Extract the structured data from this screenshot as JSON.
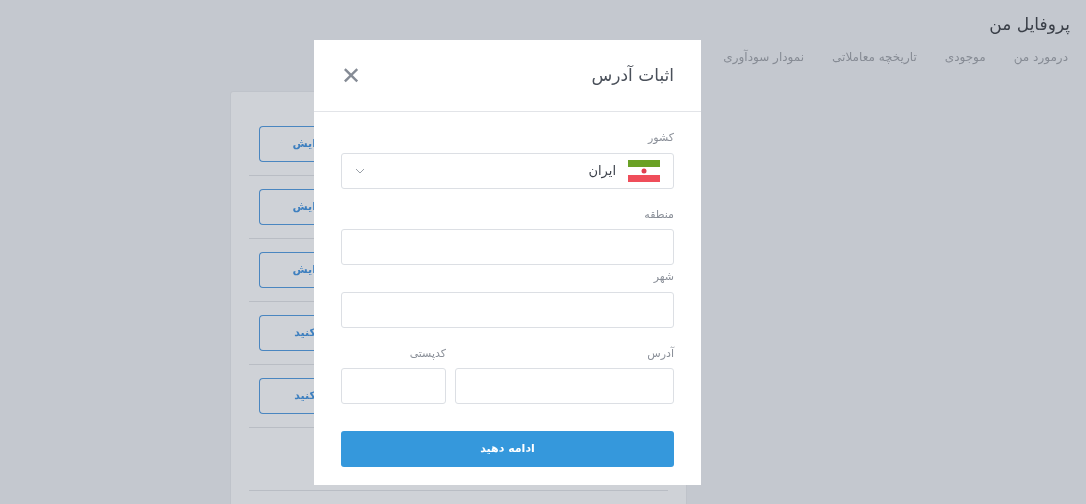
{
  "page": {
    "title": "پروفایل من",
    "tabs": [
      {
        "label": "درمورد من",
        "selected": false
      },
      {
        "label": "موجودی",
        "selected": false
      },
      {
        "label": "تاریخچه معاملاتی",
        "selected": false
      },
      {
        "label": "نمودار سودآوری",
        "selected": false
      }
    ],
    "card_rows": [
      {
        "kind": "button",
        "label": "ایش"
      },
      {
        "kind": "button",
        "label": "ایش"
      },
      {
        "kind": "button",
        "label": "ایش"
      },
      {
        "kind": "button",
        "label": "کنید"
      },
      {
        "kind": "button",
        "label": "کنید"
      },
      {
        "kind": "edge"
      }
    ]
  },
  "modal": {
    "title": "اثبات آدرس",
    "close": "✕",
    "country": {
      "label": "کشور",
      "value": "ایران"
    },
    "region": {
      "label": "منطقه"
    },
    "city": {
      "label": "شهر"
    },
    "address": {
      "label": "آدرس"
    },
    "postal_code": {
      "label": "کدپستی"
    },
    "submit": "ادامه دهید"
  }
}
